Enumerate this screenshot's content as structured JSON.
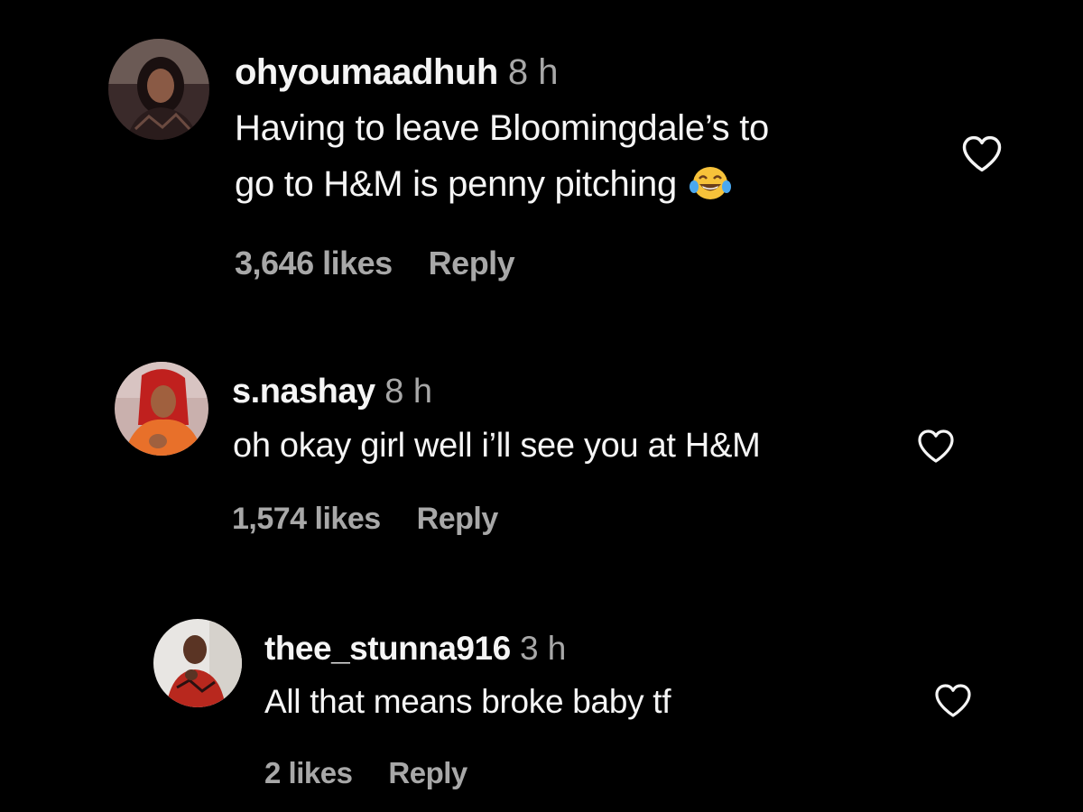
{
  "comments": [
    {
      "username": "ohyoumaadhuh",
      "time": "8 h",
      "text_line1": "Having to leave Bloomingdale’s to",
      "text_line2": "go to H&M is penny pitching",
      "emoji": "face-with-tears-of-joy-icon",
      "likes": "3,646 likes",
      "reply_label": "Reply"
    },
    {
      "username": "s.nashay",
      "time": "8 h",
      "text": "oh okay girl well i’ll see you at H&M",
      "likes": "1,574 likes",
      "reply_label": "Reply"
    },
    {
      "username": "thee_stunna916",
      "time": "3 h",
      "text": "All that means broke baby tf",
      "likes": "2 likes",
      "reply_label": "Reply"
    }
  ],
  "colors": {
    "background": "#000000",
    "primary_text": "#f5f5f5",
    "secondary_text": "#a8a8a8",
    "heart_outline": "#f5f5f5"
  }
}
